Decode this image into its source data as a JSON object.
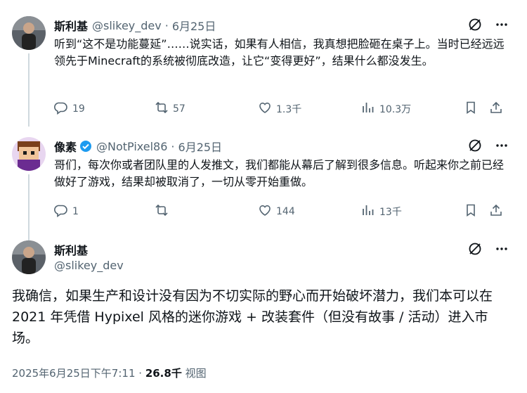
{
  "colors": {
    "text": "#0f1419",
    "secondary": "#536471",
    "line": "#cfd9de",
    "verified": "#1d9bf0"
  },
  "tweets": [
    {
      "name": "斯利基",
      "handle": "@slikey_dev",
      "date": "6月25日",
      "text": "听到“这不是功能蔓延”……说实话，如果有人相信，我真想把脸砸在桌子上。当时已经远远领先于Minecraft的系统被彻底改造，让它“变得更好”，结果什么都没发生。",
      "replies": "19",
      "retweets": "57",
      "likes": "1.3千",
      "views": "10.3万"
    },
    {
      "name": "像素",
      "handle": "@NotPixel86",
      "date": "6月25日",
      "text": "哥们，每次你或者团队里的人发推文，我们都能从幕后了解到很多信息。听起来你之前已经做好了游戏，结果却被取消了，一切从零开始重做。",
      "replies": "1",
      "retweets": "",
      "likes": "144",
      "views": "13千"
    }
  ],
  "main": {
    "name": "斯利基",
    "handle": "@slikey_dev",
    "text": "我确信，如果生产和设计没有因为不切实际的野心而开始破坏潜力，我们本可以在 2021 年凭借 Hypixel 风格的迷你游戏 + 改装套件（但没有故事 / 活动）进入市场。",
    "timestamp": "2025年6月25日下午7:11",
    "sep": " · ",
    "views_count": "26.8千",
    "views_label": "视图"
  }
}
